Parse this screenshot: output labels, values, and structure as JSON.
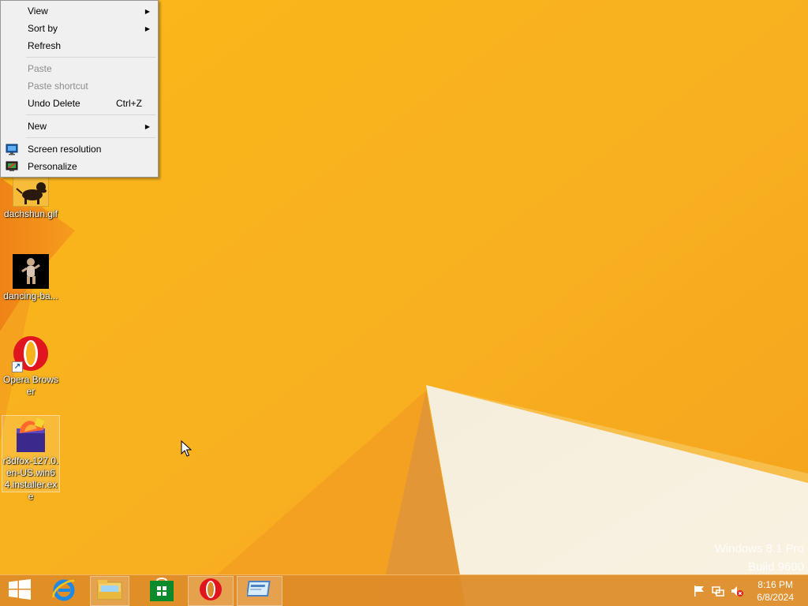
{
  "os_watermark": {
    "line1": "Windows 8.1 Pro",
    "line2": "Build 9600"
  },
  "context_menu": {
    "items": [
      {
        "label": "View",
        "has_submenu": true,
        "enabled": true
      },
      {
        "label": "Sort by",
        "has_submenu": true,
        "enabled": true
      },
      {
        "label": "Refresh",
        "enabled": true
      },
      {
        "label": "Paste",
        "enabled": false
      },
      {
        "label": "Paste shortcut",
        "enabled": false
      },
      {
        "label": "Undo Delete",
        "shortcut": "Ctrl+Z",
        "enabled": true
      },
      {
        "label": "New",
        "has_submenu": true,
        "enabled": true
      },
      {
        "label": "Screen resolution",
        "icon": "monitor-icon",
        "enabled": true
      },
      {
        "label": "Personalize",
        "icon": "personalize-icon",
        "enabled": true
      }
    ]
  },
  "desktop_icons": [
    {
      "label": "dachshun.gif",
      "icon": "dachshund-image-icon"
    },
    {
      "label": "dancing-ba...",
      "icon": "dancing-baby-image-icon"
    },
    {
      "label": "Opera Browser",
      "icon": "opera-icon",
      "shortcut": true
    },
    {
      "label": "r3dfox-127.0.en-US.win64.installer.exe",
      "icon": "r3dfox-installer-icon",
      "selected": true
    }
  ],
  "taskbar": {
    "buttons": [
      {
        "name": "start",
        "icon": "windows-logo-icon"
      },
      {
        "name": "internet-explorer",
        "icon": "internet-explorer-icon"
      },
      {
        "name": "file-explorer",
        "icon": "folder-icon"
      },
      {
        "name": "store",
        "icon": "store-icon"
      },
      {
        "name": "opera",
        "icon": "opera-icon",
        "open": true
      },
      {
        "name": "window",
        "icon": "window-icon",
        "open": true
      }
    ],
    "tray": {
      "icons": [
        "action-center-flag-icon",
        "network-icon",
        "volume-muted-icon"
      ],
      "time": "8:16 PM",
      "date": "6/8/2024"
    }
  },
  "colors": {
    "wallpaper": "#F7B21C",
    "taskbar": "#DE8C28",
    "menu_background": "#F0F0F0",
    "menu_disabled_text": "#8D8D8D"
  }
}
